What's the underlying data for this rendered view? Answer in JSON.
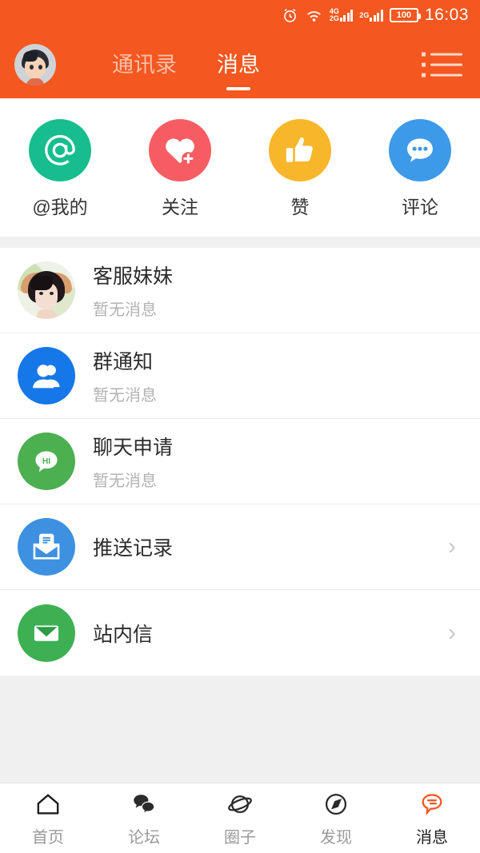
{
  "status_bar": {
    "alarm_icon": "alarm-clock-icon",
    "wifi_icon": "wifi-icon",
    "signal1_label_top": "4G",
    "signal1_label_bottom": "2G",
    "signal2_label": "2G",
    "battery_level": "100",
    "time": "16:03"
  },
  "header": {
    "avatar_name": "user-avatar",
    "menu_label": "list-menu",
    "tabs": [
      {
        "label": "通讯录",
        "active": false
      },
      {
        "label": "消息",
        "active": true
      }
    ]
  },
  "quick_actions": [
    {
      "label": "@我的",
      "icon": "at-icon",
      "color": "#17bd8d"
    },
    {
      "label": "关注",
      "icon": "heart-plus-icon",
      "color": "#f65d63"
    },
    {
      "label": "赞",
      "icon": "thumbs-up-icon",
      "color": "#f8b62b"
    },
    {
      "label": "评论",
      "icon": "comment-dots-icon",
      "color": "#3d9ae8"
    }
  ],
  "message_list": [
    {
      "title": "客服妹妹",
      "subtitle": "暂无消息",
      "icon": "photo-avatar",
      "color": "#e8ecdf",
      "chevron": ""
    },
    {
      "title": "群通知",
      "subtitle": "暂无消息",
      "icon": "group-users-icon",
      "color": "#1677e8",
      "chevron": ""
    },
    {
      "title": "聊天申请",
      "subtitle": "暂无消息",
      "icon": "hi-bubble-icon",
      "color": "#4caf50",
      "chevron": ""
    },
    {
      "title": "推送记录",
      "subtitle": "",
      "icon": "inbox-letter-icon",
      "color": "#3d91e0",
      "chevron": "›"
    },
    {
      "title": "站内信",
      "subtitle": "",
      "icon": "envelope-icon",
      "color": "#3eb054",
      "chevron": "›"
    }
  ],
  "bottom_nav": [
    {
      "label": "首页",
      "icon": "home-icon",
      "active": false
    },
    {
      "label": "论坛",
      "icon": "chat-bubbles-icon",
      "active": false
    },
    {
      "label": "圈子",
      "icon": "planet-icon",
      "active": false
    },
    {
      "label": "发现",
      "icon": "compass-icon",
      "active": false
    },
    {
      "label": "消息",
      "icon": "message-bubble-icon",
      "active": true
    }
  ],
  "colors": {
    "brand_orange": "#f4571f",
    "active_nav": "#f4571f",
    "page_background": "#f0f0f0",
    "card_background": "#ffffff"
  },
  "hi_badge_text": "HI"
}
